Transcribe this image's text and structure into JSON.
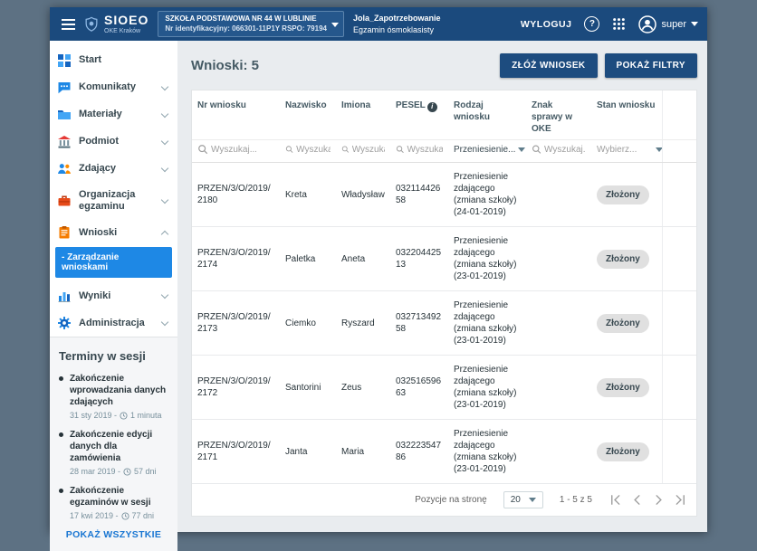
{
  "icons": {
    "help": "?",
    "info": "i",
    "clear": "×"
  },
  "topbar": {
    "brand": "SIOEO",
    "brand_subtitle": "OKE Kraków",
    "school": {
      "name": "SZKOŁA PODSTAWOWA NR 44 W LUBLINIE",
      "details": "Nr identyfikacyjny: 066301-11P1Y RSPO: 79194"
    },
    "context": {
      "line1": "Jola_Zapotrzebowanie",
      "line2": "Egzamin ósmoklasisty"
    },
    "logout_label": "WYLOGUJ",
    "username": "super"
  },
  "sidebar": {
    "items": [
      {
        "label": "Start",
        "icon": "dashboard-icon"
      },
      {
        "label": "Komunikaty",
        "icon": "chat-icon"
      },
      {
        "label": "Materiały",
        "icon": "folder-icon"
      },
      {
        "label": "Podmiot",
        "icon": "building-icon"
      },
      {
        "label": "Zdający",
        "icon": "people-icon"
      },
      {
        "label": "Organizacja egzaminu",
        "icon": "briefcase-icon"
      },
      {
        "label": "Wnioski",
        "icon": "clipboard-icon"
      },
      {
        "label": "Wyniki",
        "icon": "chart-icon"
      },
      {
        "label": "Administracja",
        "icon": "gear-icon"
      }
    ],
    "active_subitem": "- Zarządzanie wnioskami",
    "terms": {
      "title": "Terminy w sesji",
      "items": [
        {
          "title": "Zakończenie wprowadzania danych zdających",
          "date": "31 sty 2019 -",
          "remaining": "1 minuta"
        },
        {
          "title": "Zakończenie edycji danych dla zamówienia",
          "date": "28 mar 2019 -",
          "remaining": "57 dni"
        },
        {
          "title": "Zakończenie egzaminów w sesji",
          "date": "17 kwi 2019 -",
          "remaining": "77 dni"
        }
      ],
      "show_all_label": "POKAŻ WSZYSTKIE"
    }
  },
  "main": {
    "title": "Wnioski: 5",
    "actions": {
      "submit": "ZŁÓŻ WNIOSEK",
      "filters": "POKAŻ FILTRY"
    },
    "table": {
      "columns": [
        "Nr wniosku",
        "Nazwisko",
        "Imiona",
        "PESEL",
        "Rodzaj wniosku",
        "Znak sprawy w OKE",
        "Stan wniosku"
      ],
      "filters": {
        "search_placeholder": "Wyszukaj...",
        "rodzaj_value": "Przeniesienie...",
        "stan_placeholder": "Wybierz..."
      },
      "rows": [
        {
          "nr": "PRZEN/3/O/2019/2180",
          "nazwisko": "Kreta",
          "imiona": "Władysław",
          "pesel": "03211442658",
          "rodzaj": "Przeniesienie zdającego (zmiana szkoły) (24-01-2019)",
          "znak": "",
          "stan": "Złożony"
        },
        {
          "nr": "PRZEN/3/O/2019/2174",
          "nazwisko": "Paletka",
          "imiona": "Aneta",
          "pesel": "03220442513",
          "rodzaj": "Przeniesienie zdającego (zmiana szkoły) (23-01-2019)",
          "znak": "",
          "stan": "Złożony"
        },
        {
          "nr": "PRZEN/3/O/2019/2173",
          "nazwisko": "Ciemko",
          "imiona": "Ryszard",
          "pesel": "03271349258",
          "rodzaj": "Przeniesienie zdającego (zmiana szkoły) (23-01-2019)",
          "znak": "",
          "stan": "Złożony"
        },
        {
          "nr": "PRZEN/3/O/2019/2172",
          "nazwisko": "Santorini",
          "imiona": "Zeus",
          "pesel": "03251659663",
          "rodzaj": "Przeniesienie zdającego (zmiana szkoły) (23-01-2019)",
          "znak": "",
          "stan": "Złożony"
        },
        {
          "nr": "PRZEN/3/O/2019/2171",
          "nazwisko": "Janta",
          "imiona": "Maria",
          "pesel": "03222354786",
          "rodzaj": "Przeniesienie zdającego (zmiana szkoły) (23-01-2019)",
          "znak": "",
          "stan": "Złożony"
        }
      ],
      "pagination": {
        "per_page_label": "Pozycje na stronę",
        "per_page_value": "20",
        "range": "1 - 5 z 5"
      }
    }
  },
  "colors": {
    "topbar_navy": "#1b4a7d",
    "accent_blue": "#1e88e5",
    "button_navy": "#1d4c7f",
    "badge_gray": "#e0e0e0"
  }
}
